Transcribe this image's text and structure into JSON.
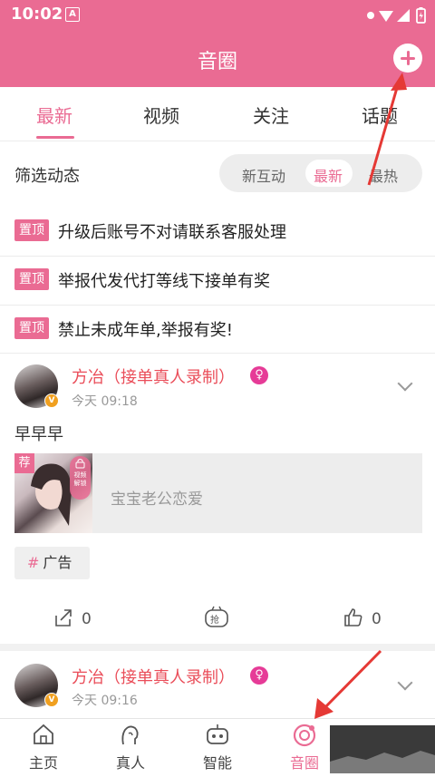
{
  "status": {
    "time": "10:02",
    "app_icon": "A"
  },
  "header": {
    "title": "音圈",
    "add_icon": "plus-circle-icon"
  },
  "tabs": [
    {
      "label": "最新",
      "active": true
    },
    {
      "label": "视频",
      "active": false
    },
    {
      "label": "关注",
      "active": false
    },
    {
      "label": "话题",
      "active": false
    }
  ],
  "filter": {
    "label": "筛选动态",
    "options": [
      {
        "label": "新互动",
        "active": false
      },
      {
        "label": "最新",
        "active": true
      },
      {
        "label": "最热",
        "active": false
      }
    ]
  },
  "pinned": [
    {
      "badge": "置顶",
      "text": "升级后账号不对请联系客服处理"
    },
    {
      "badge": "置顶",
      "text": "举报代发代打等线下接单有奖"
    },
    {
      "badge": "置顶",
      "text": "禁止未成年单,举报有奖!"
    }
  ],
  "post1": {
    "name": "方冶（接单真人录制）",
    "gender_symbol": "♀",
    "verified": "V",
    "time": "今天 09:18",
    "text": "早早早",
    "card": {
      "rec_tag": "荐",
      "lock_line1": "视频",
      "lock_line2": "解锁",
      "title": "宝宝老公恋爱"
    },
    "ad_tag": {
      "hash": "#",
      "label": "广告"
    },
    "share_count": "0",
    "like_count": "0",
    "grab_label": "抢"
  },
  "post2": {
    "name": "方冶（接单真人录制）",
    "gender_symbol": "♀",
    "verified": "V",
    "time": "今天 09:16"
  },
  "bottom_nav": [
    {
      "label": "主页",
      "icon": "home-icon",
      "active": false
    },
    {
      "label": "真人",
      "icon": "person-voice-icon",
      "active": false
    },
    {
      "label": "智能",
      "icon": "robot-icon",
      "active": false
    },
    {
      "label": "音圈",
      "icon": "circle-refresh-icon",
      "active": true
    }
  ],
  "colors": {
    "accent": "#ea6b93",
    "name_red": "#ea4d59",
    "female_pink": "#e63b97",
    "arrow_red": "#e53935"
  }
}
